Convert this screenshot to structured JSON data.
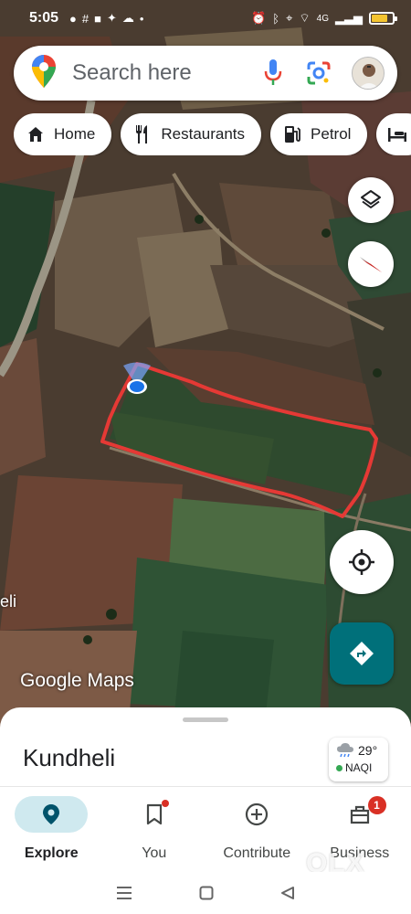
{
  "status_bar": {
    "time": "5:05",
    "network": "4G"
  },
  "search": {
    "placeholder": "Search here"
  },
  "chips": [
    {
      "label": "Home",
      "icon": "home-icon"
    },
    {
      "label": "Restaurants",
      "icon": "restaurant-icon"
    },
    {
      "label": "Petrol",
      "icon": "gas-station-icon"
    },
    {
      "label": "",
      "icon": "hotel-icon"
    }
  ],
  "map": {
    "watermark": "Google Maps",
    "edge_label": "eli",
    "boundary_color": "#e53935"
  },
  "sheet": {
    "place_name": "Kundheli",
    "weather": {
      "temperature": "29°",
      "aqi_label": "NAQI"
    }
  },
  "nav": {
    "items": [
      {
        "label": "Explore",
        "icon": "explore-pin-icon",
        "active": true
      },
      {
        "label": "You",
        "icon": "bookmark-icon",
        "active": false
      },
      {
        "label": "Contribute",
        "icon": "add-circle-icon",
        "active": false
      },
      {
        "label": "Business",
        "icon": "store-icon",
        "active": false,
        "badge": "1"
      }
    ]
  },
  "overlay_watermark": "OLX",
  "colors": {
    "accent": "#00707a",
    "explore_active_bg": "#cfe9ef",
    "badge": "#d93025"
  }
}
